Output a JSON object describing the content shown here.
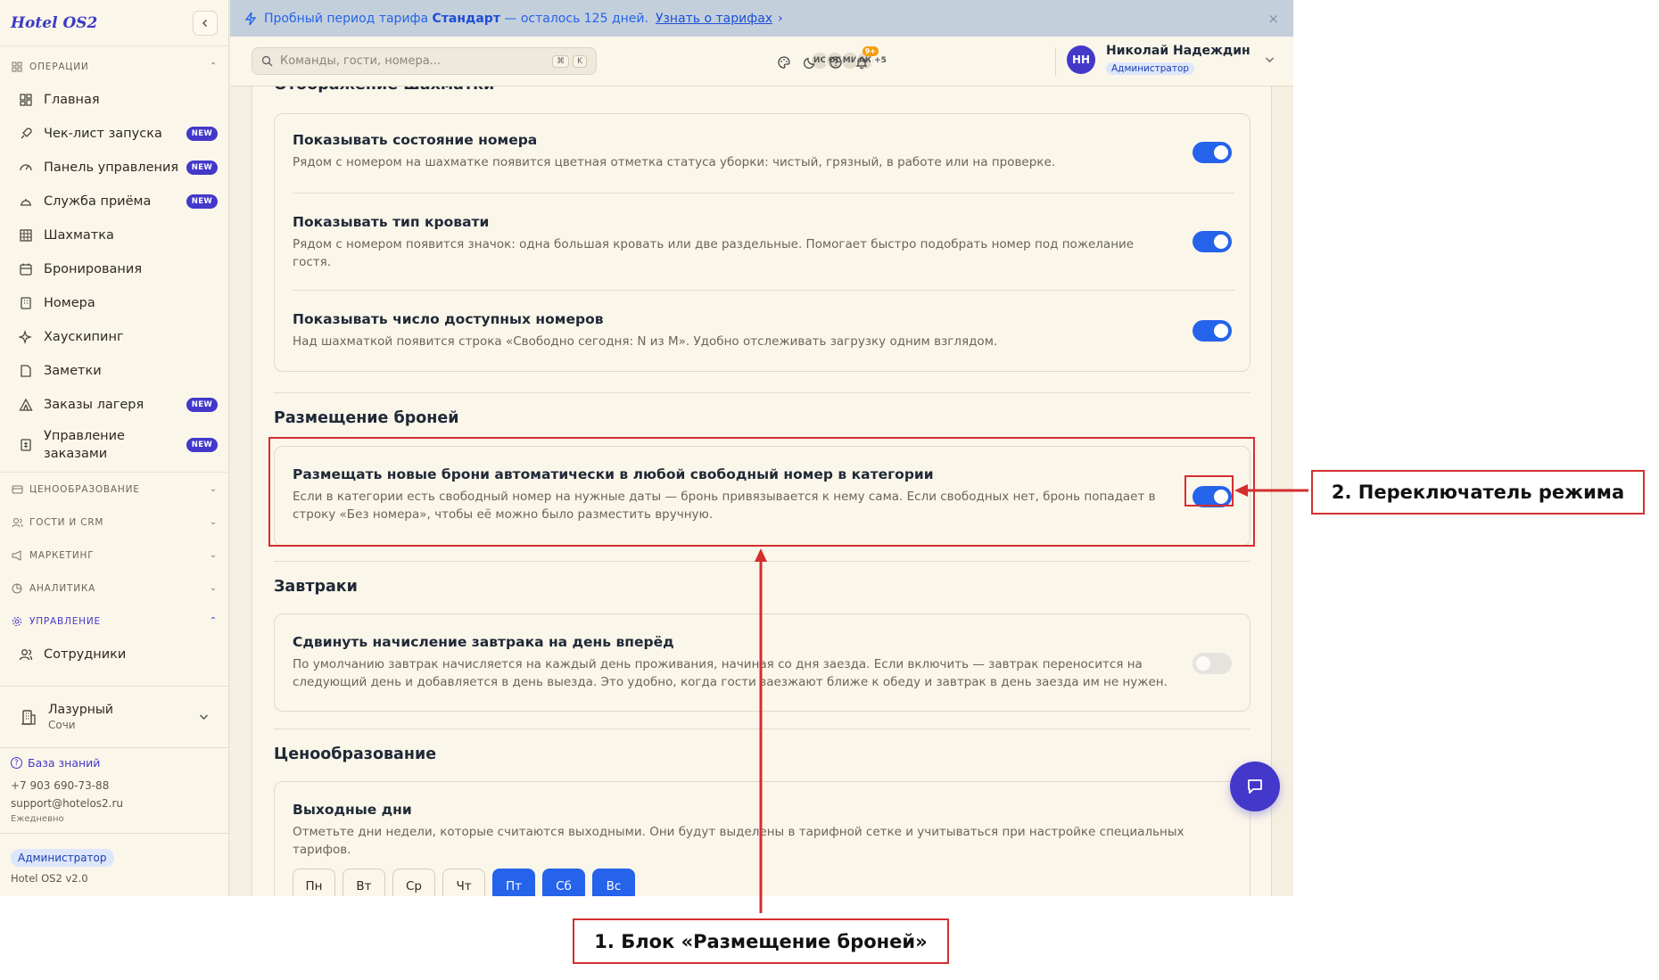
{
  "sidebar": {
    "brand": "Hotel OS2",
    "sections": {
      "operations": "ОПЕРАЦИИ",
      "pricing": "ЦЕНООБРАЗОВАНИЕ",
      "guests": "ГОСТИ И CRM",
      "marketing": "МАРКЕТИНГ",
      "analytics": "АНАЛИТИКА",
      "management": "УПРАВЛЕНИЕ"
    },
    "items": [
      {
        "label": "Главная",
        "badge": ""
      },
      {
        "label": "Чек-лист запуска",
        "badge": "NEW"
      },
      {
        "label": "Панель управления",
        "badge": "NEW"
      },
      {
        "label": "Служба приёма",
        "badge": "NEW"
      },
      {
        "label": "Шахматка",
        "badge": ""
      },
      {
        "label": "Бронирования",
        "badge": ""
      },
      {
        "label": "Номера",
        "badge": ""
      },
      {
        "label": "Хаускипинг",
        "badge": ""
      },
      {
        "label": "Заметки",
        "badge": ""
      },
      {
        "label": "Заказы лагеря",
        "badge": "NEW"
      },
      {
        "label": "Управление заказами",
        "badge": "NEW"
      }
    ],
    "staff_item": "Сотрудники",
    "hotel": {
      "name": "Лазурный",
      "city": "Сочи"
    },
    "footer": {
      "knowledge_base": "База знаний",
      "phone": "+7 903 690-73-88",
      "email": "support@hotelos2.ru",
      "schedule": "Ежедневно",
      "role": "Администратор",
      "version": "Hotel OS2 v2.0"
    }
  },
  "banner": {
    "text_before": "Пробный период тарифа",
    "plan": "Стандарт",
    "text_after": "— осталось 125 дней.",
    "link": "Узнать о тарифах",
    "link_arrow": "›",
    "close": "×"
  },
  "topbar": {
    "search_placeholder": "Команды, гости, номера...",
    "kbd1": "⌘",
    "kbd2": "K",
    "avatars": [
      "ИС",
      "ОС",
      "МИ",
      "АК"
    ],
    "avatars_more": "+5",
    "notif_count": "9+",
    "user": {
      "initials": "НН",
      "name": "Николай Надеждин",
      "role": "Администратор"
    }
  },
  "content": {
    "section_grid": "Отображение шахматки",
    "row_state": {
      "title": "Показывать состояние номера",
      "desc": "Рядом с номером на шахматке появится цветная отметка статуса уборки: чистый, грязный, в работе или на проверке.",
      "enabled": true
    },
    "row_bed": {
      "title": "Показывать тип кровати",
      "desc": "Рядом с номером появится значок: одна большая кровать или две раздельные. Помогает быстро подобрать номер под пожелание гостя.",
      "enabled": true
    },
    "row_avail": {
      "title": "Показывать число доступных номеров",
      "desc": "Над шахматкой появится строка «Свободно сегодня: N из M». Удобно отслеживать загрузку одним взглядом.",
      "enabled": true
    },
    "section_placement": "Размещение броней",
    "row_auto": {
      "title": "Размещать новые брони автоматически в любой свободный номер в категории",
      "desc": "Если в категории есть свободный номер на нужные даты — бронь привязывается к нему сама. Если свободных нет, бронь попадает в строку «Без номера», чтобы её можно было разместить вручную.",
      "enabled": true
    },
    "section_breakfast": "Завтраки",
    "row_breakfast": {
      "title": "Сдвинуть начисление завтрака на день вперёд",
      "desc": "По умолчанию завтрак начисляется на каждый день проживания, начиная со дня заезда. Если включить — завтрак переносится на следующий день и добавляется в день выезда. Это удобно, когда гости заезжают ближе к обеду и завтрак в день заезда им не нужен.",
      "enabled": false
    },
    "section_pricing": "Ценообразование",
    "row_weekend": {
      "title": "Выходные дни",
      "desc": "Отметьте дни недели, которые считаются выходными. Они будут выделены в тарифной сетке и учитываться при настройке специальных тарифов."
    },
    "days": [
      {
        "label": "Пн",
        "selected": false
      },
      {
        "label": "Вт",
        "selected": false
      },
      {
        "label": "Ср",
        "selected": false
      },
      {
        "label": "Чт",
        "selected": false
      },
      {
        "label": "Пт",
        "selected": true
      },
      {
        "label": "Сб",
        "selected": true
      },
      {
        "label": "Вс",
        "selected": true
      }
    ]
  },
  "annotations": {
    "label1": "1. Блок «Размещение броней»",
    "label2": "2. Переключатель режима"
  },
  "colors": {
    "accent": "#2563eb",
    "brand": "#4338ca",
    "annotation": "#d32f2f"
  }
}
